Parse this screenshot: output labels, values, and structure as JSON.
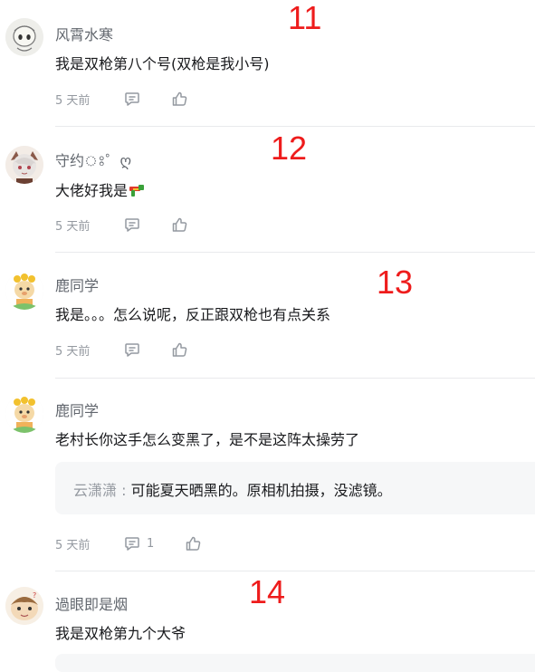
{
  "comments": [
    {
      "username": "风霄水寒",
      "text": "我是双枪第八个号(双枪是我小号)",
      "time": "5 天前",
      "annotation": "11"
    },
    {
      "username": "守约ঃ゜ღ",
      "text": "大佬好我是",
      "time": "5 天前",
      "annotation": "12"
    },
    {
      "username": "鹿同学",
      "text": "我是。。。怎么说呢，反正跟双枪也有点关系",
      "time": "5 天前",
      "annotation": "13"
    },
    {
      "username": "鹿同学",
      "text": "老村长你这手怎么变黑了，是不是这阵太操劳了",
      "time": "5 天前",
      "reply_count": "1",
      "reply": {
        "user": "云潇潇",
        "separator": " : ",
        "text": "可能夏天晒黑的。原相机拍摄，没滤镜。"
      }
    },
    {
      "username": "過眼即是烟",
      "text": "我是双枪第九个大爷",
      "annotation": "14"
    }
  ],
  "icons": {
    "reply": "comment-bubble-icon",
    "like": "thumbs-up-icon"
  },
  "colors": {
    "annotation": "#ee1c1c",
    "username": "#61666d",
    "meta": "#9499a0",
    "reply_box": "#f6f7f8"
  }
}
